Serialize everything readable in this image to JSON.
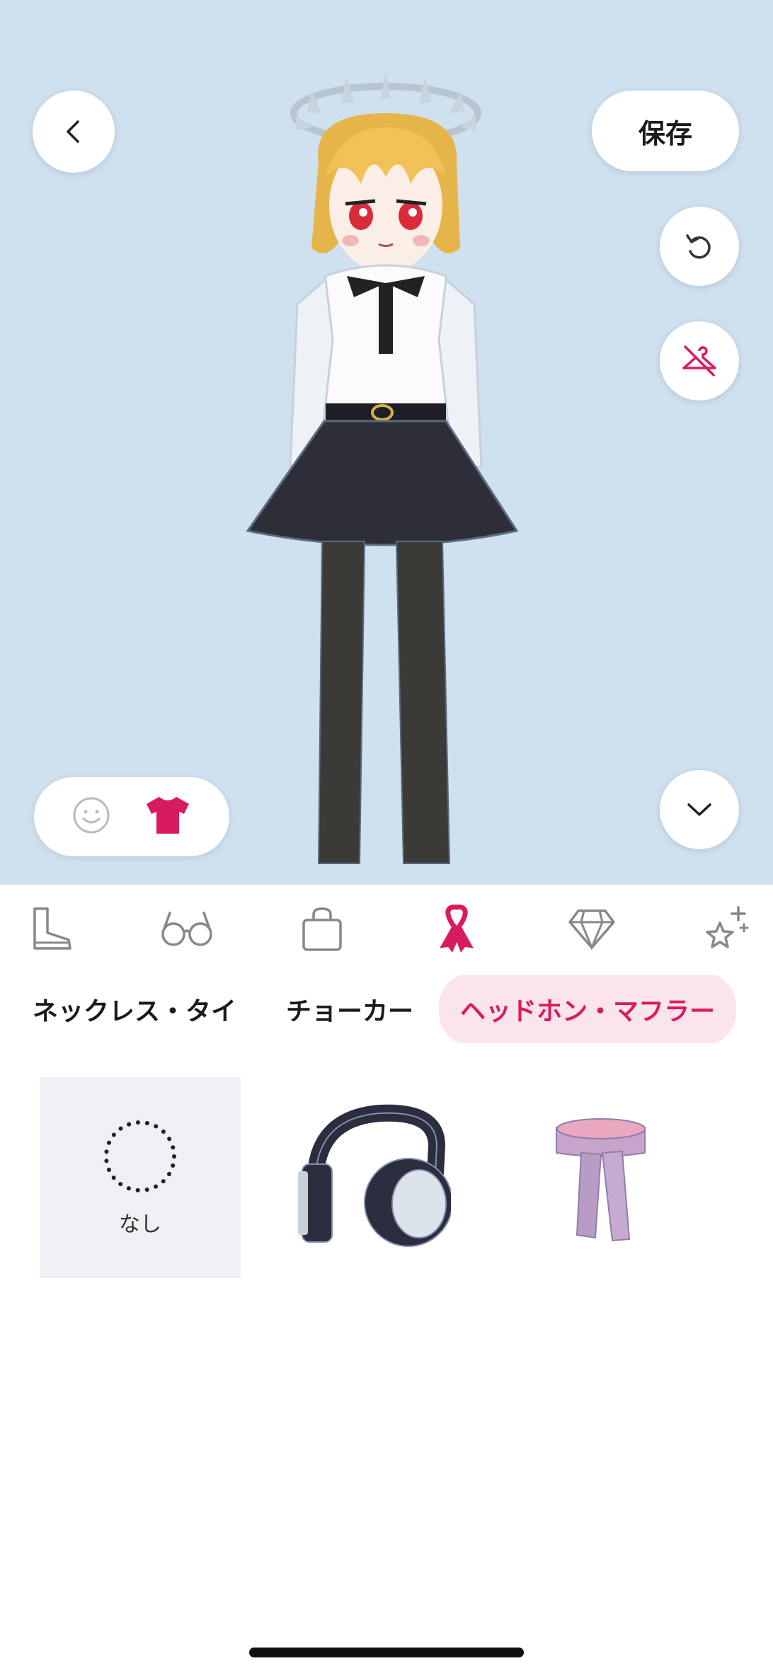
{
  "header": {
    "save_label": "保存",
    "back_icon": "chevron-left-icon",
    "undo_icon": "undo-icon",
    "hide_clothes_icon": "hanger-slash-icon",
    "collapse_icon": "chevron-down-icon"
  },
  "mode_toggle": {
    "face_icon": "smile-icon",
    "clothes_icon": "tshirt-icon",
    "active": "clothes"
  },
  "categories": [
    {
      "icon": "boot-icon",
      "active": false
    },
    {
      "icon": "glasses-icon",
      "active": false
    },
    {
      "icon": "bag-icon",
      "active": false
    },
    {
      "icon": "ribbon-icon",
      "active": true
    },
    {
      "icon": "diamond-icon",
      "active": false
    },
    {
      "icon": "sparkle-star-icon",
      "active": false
    }
  ],
  "sub_tabs": [
    {
      "label": "ネックレス・タイ",
      "active": false
    },
    {
      "label": "チョーカー",
      "active": false
    },
    {
      "label": "ヘッドホン・マフラー",
      "active": true
    }
  ],
  "items": [
    {
      "label": "なし",
      "icon": "none-dotted-circle-icon",
      "selected": true
    },
    {
      "icon": "headphones-icon",
      "selected": false
    },
    {
      "icon": "scarf-icon",
      "selected": false
    }
  ],
  "colors": {
    "accent": "#d81b60",
    "accent_bg": "#fce4ec",
    "preview_bg": "#f4f6f9"
  }
}
